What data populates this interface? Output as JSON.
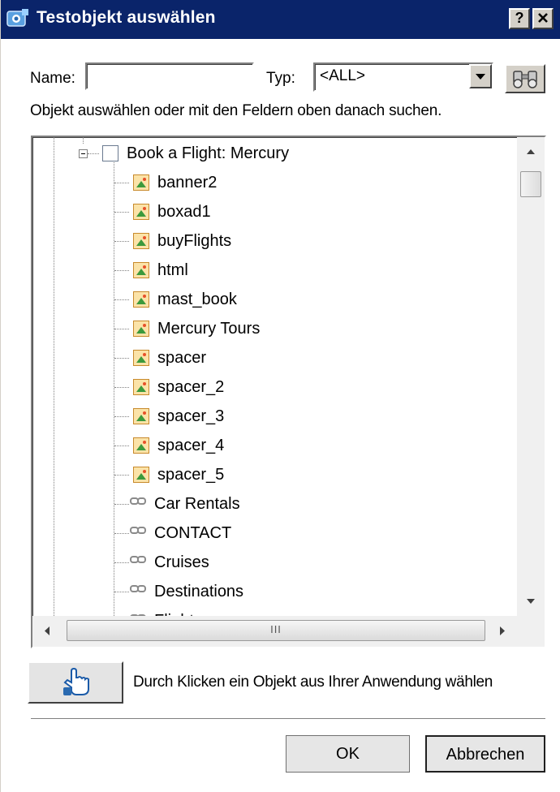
{
  "window": {
    "title": "Testobjekt auswählen",
    "help_button": "?",
    "close_button": "✕"
  },
  "search": {
    "name_label": "Name:",
    "name_value": "",
    "type_label": "Typ:",
    "type_selected": "<ALL>",
    "instructions": "Objekt auswählen oder mit den Feldern oben danach suchen."
  },
  "tree": {
    "root": {
      "label": "Book a Flight: Mercury",
      "icon": "page-icon",
      "expanded": true
    },
    "children": [
      {
        "label": "banner2",
        "icon": "image-icon"
      },
      {
        "label": "boxad1",
        "icon": "image-icon"
      },
      {
        "label": "buyFlights",
        "icon": "image-icon"
      },
      {
        "label": "html",
        "icon": "image-icon"
      },
      {
        "label": "mast_book",
        "icon": "image-icon"
      },
      {
        "label": "Mercury Tours",
        "icon": "image-icon"
      },
      {
        "label": "spacer",
        "icon": "image-icon"
      },
      {
        "label": "spacer_2",
        "icon": "image-icon"
      },
      {
        "label": "spacer_3",
        "icon": "image-icon"
      },
      {
        "label": "spacer_4",
        "icon": "image-icon"
      },
      {
        "label": "spacer_5",
        "icon": "image-icon"
      },
      {
        "label": "Car Rentals",
        "icon": "link-icon"
      },
      {
        "label": "CONTACT",
        "icon": "link-icon"
      },
      {
        "label": "Cruises",
        "icon": "link-icon"
      },
      {
        "label": "Destinations",
        "icon": "link-icon"
      },
      {
        "label": "Flights",
        "icon": "link-icon"
      }
    ],
    "hscroll_grip": "III"
  },
  "pick": {
    "description": "Durch Klicken ein Objekt aus Ihrer Anwendung wählen"
  },
  "footer": {
    "ok_label": "OK",
    "cancel_label": "Abbrechen"
  },
  "colors": {
    "titlebar": "#0a246a",
    "dialog_face": "#d4d0c8"
  }
}
